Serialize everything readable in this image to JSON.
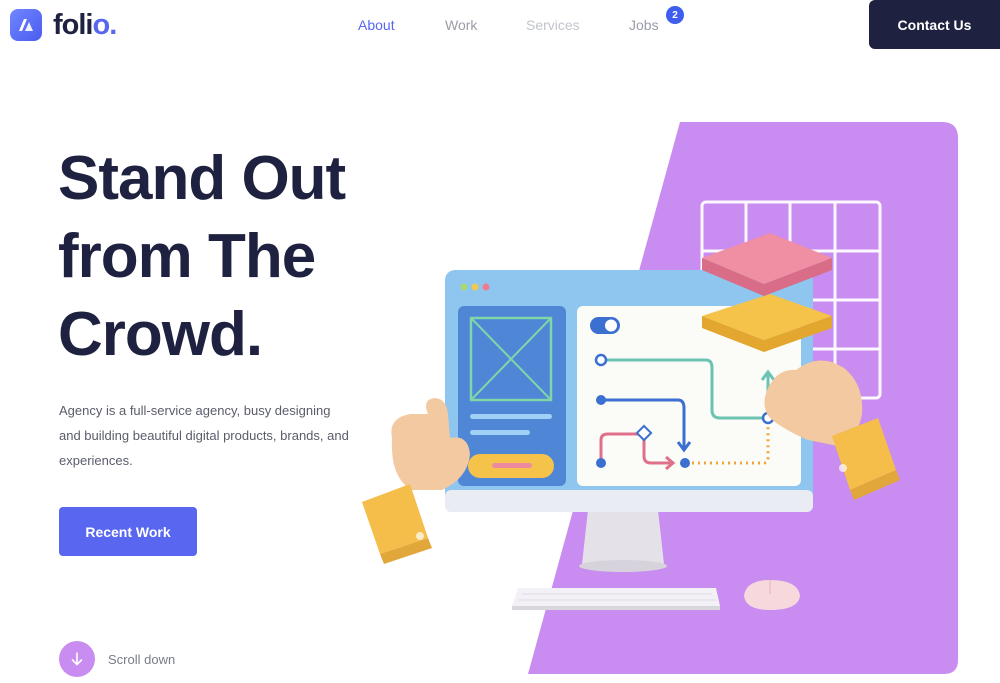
{
  "brand": {
    "name": "foli",
    "dot": "o."
  },
  "nav": {
    "items": [
      {
        "label": "About"
      },
      {
        "label": "Work"
      },
      {
        "label": "Services"
      },
      {
        "label": "Jobs"
      }
    ],
    "jobs_badge": "2",
    "contact_label": "Contact Us"
  },
  "hero": {
    "title_line1": "Stand Out",
    "title_line2": "from The",
    "title_line3": "Crowd.",
    "description": "Agency is a full-service agency, busy designing and building beautiful digital products, brands, and experiences.",
    "cta_label": "Recent Work"
  },
  "scroll": {
    "label": "Scroll down"
  },
  "colors": {
    "primary": "#5866f0",
    "dark": "#1f2140",
    "accent_purple": "#c98cf0",
    "badge_blue": "#3f5ef0"
  },
  "icons": [
    "logo-mark-icon",
    "arrow-down-icon"
  ]
}
